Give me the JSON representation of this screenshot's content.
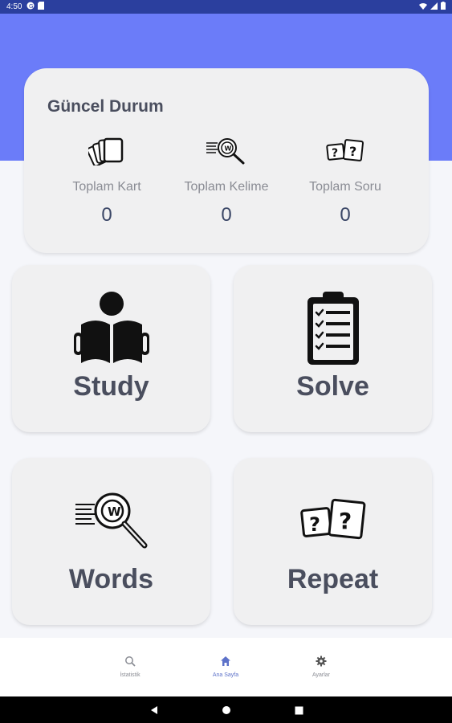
{
  "status_bar": {
    "time": "4:50"
  },
  "summary": {
    "title": "Güncel Durum",
    "stats": [
      {
        "label": "Toplam Kart",
        "value": "0",
        "icon": "cards-icon"
      },
      {
        "label": "Toplam Kelime",
        "value": "0",
        "icon": "word-search-icon"
      },
      {
        "label": "Toplam Soru",
        "value": "0",
        "icon": "question-cards-icon"
      }
    ]
  },
  "tiles": [
    {
      "label": "Study",
      "icon": "reading-person-icon"
    },
    {
      "label": "Solve",
      "icon": "clipboard-checklist-icon"
    },
    {
      "label": "Words",
      "icon": "word-search-icon"
    },
    {
      "label": "Repeat",
      "icon": "question-cards-icon"
    }
  ],
  "bottom_nav": [
    {
      "label": "İstatistik",
      "icon": "search-icon",
      "active": false
    },
    {
      "label": "Ana Sayfa",
      "icon": "home-icon",
      "active": true
    },
    {
      "label": "Ayarlar",
      "icon": "gear-icon",
      "active": false
    }
  ],
  "colors": {
    "status_bar": "#2b3f9e",
    "header": "#6b7cf9",
    "card": "#f0f0f1",
    "text_dark": "#4a4e5e",
    "active_nav": "#5d72c9"
  }
}
